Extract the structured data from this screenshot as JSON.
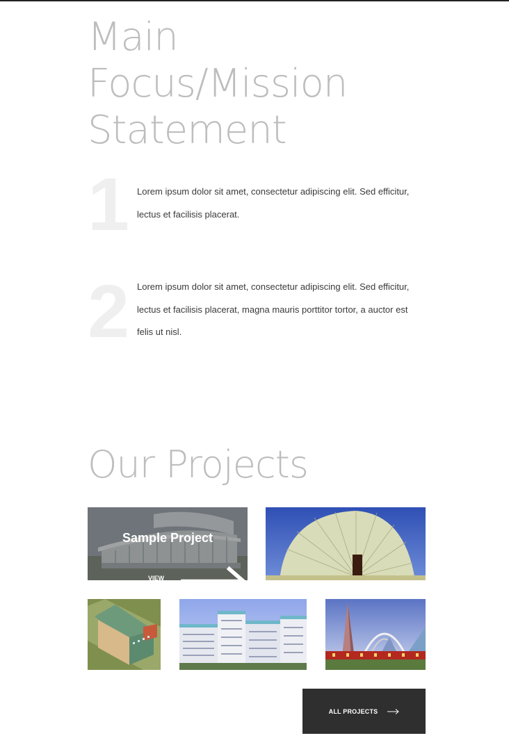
{
  "mission": {
    "title_lines": [
      "Main",
      "Focus/Mission",
      "Statement"
    ],
    "items": [
      {
        "number": "1",
        "text": "Lorem ipsum dolor sit amet, consectetur adipiscing elit. Sed efficitur, lectus et facilisis placerat."
      },
      {
        "number": "2",
        "text": "Lorem ipsum dolor sit amet, consectetur adipiscing elit. Sed efficitur, lectus et facilisis placerat, magna mauris porttitor tortor, a auctor est felis ut nisl."
      }
    ]
  },
  "projects": {
    "title": "Our Projects",
    "featured": {
      "title": "Sample Project",
      "view_more": "VIEW MORE",
      "icon": "arrow-right-icon"
    },
    "all_projects_label": "ALL PROJECTS",
    "all_projects_icon": "arrow-right-icon"
  },
  "colors": {
    "heading": "#bdbdbd",
    "number": "#efefef",
    "body_text": "#3a3a3a",
    "button_bg": "#2f2f2f"
  }
}
